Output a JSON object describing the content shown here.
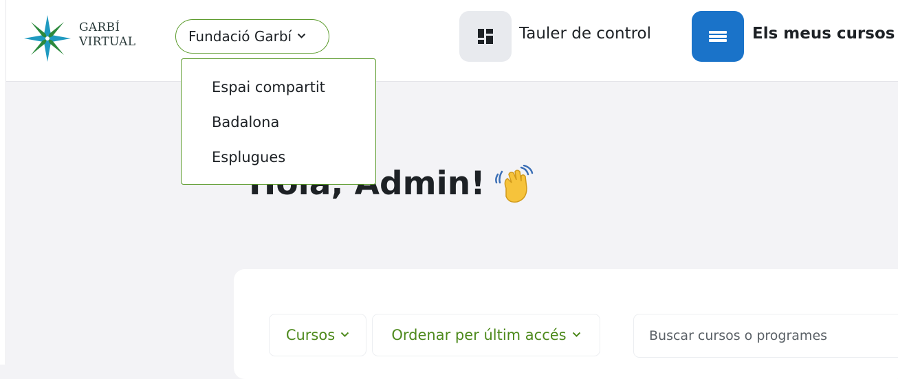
{
  "brand": {
    "line1": "GARBÍ",
    "line2": "VIRTUAL"
  },
  "org_select": {
    "value": "Fundació Garbí"
  },
  "org_menu": {
    "items": [
      "Espai compartit",
      "Badalona",
      "Esplugues"
    ]
  },
  "nav": {
    "dashboard_label": "Tauler de control",
    "mycourses_label": "Els meus cursos"
  },
  "greeting": "Hola, Admin!",
  "filters": {
    "courses_label": "Cursos",
    "sort_label": "Ordenar per últim accés"
  },
  "search": {
    "placeholder": "Buscar cursos o programes"
  },
  "colors": {
    "accent_green": "#5a9a2a",
    "primary_blue": "#1a73c9",
    "filter_text": "#4e8a1d"
  },
  "icons": {
    "dashboard": "dashboard-icon",
    "courses": "list-icon",
    "wave": "waving-hand-icon",
    "chevron": "chevron-down-icon"
  }
}
